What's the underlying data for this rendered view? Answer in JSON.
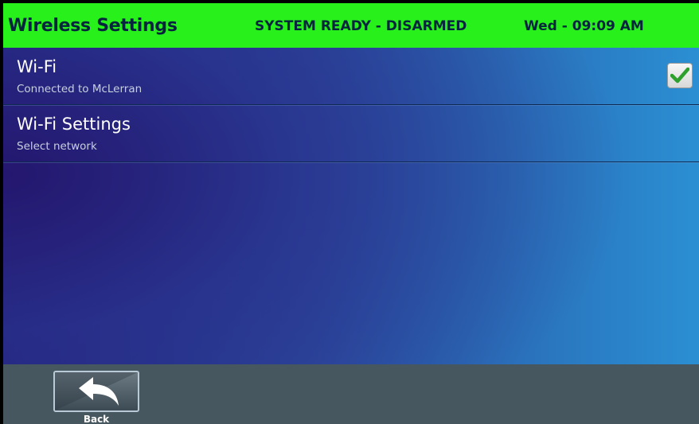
{
  "header": {
    "title": "Wireless Settings",
    "status": "SYSTEM READY - DISARMED",
    "clock": "Wed - 09:09 AM",
    "background_color": "#28f01a"
  },
  "list": {
    "items": [
      {
        "label": "Wi-Fi",
        "sublabel": "Connected to McLerran",
        "checked": true
      },
      {
        "label": "Wi-Fi Settings",
        "sublabel": "Select network"
      }
    ]
  },
  "footer": {
    "back_label": "Back",
    "back_icon": "back-arrow-icon"
  }
}
